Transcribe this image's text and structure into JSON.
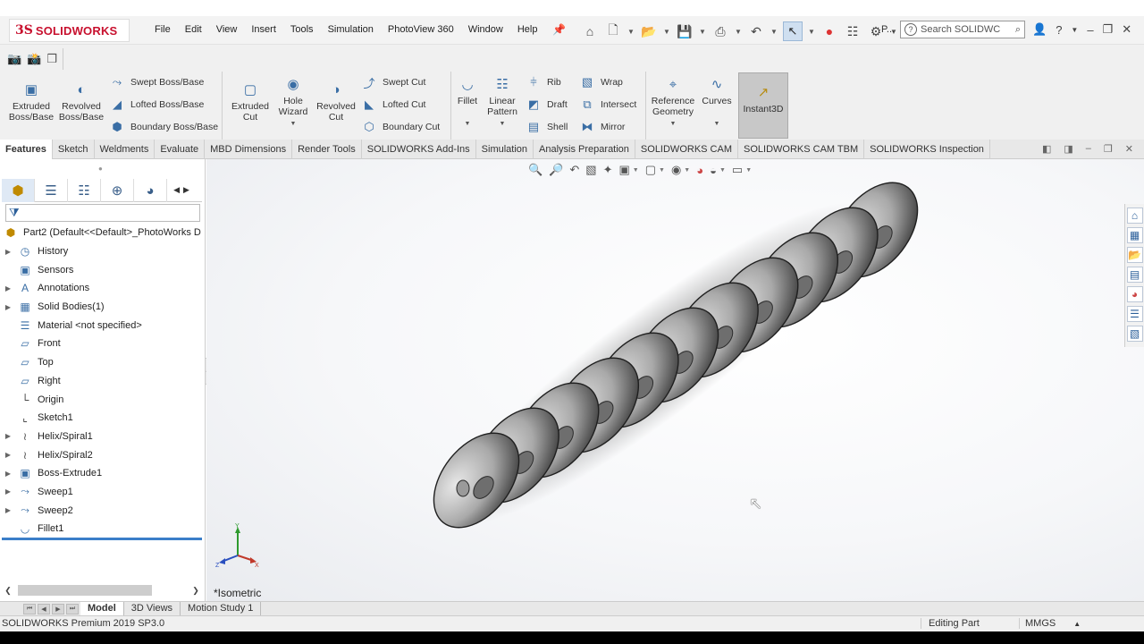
{
  "app": {
    "brand_ds": "3S",
    "brand_name": "SOLIDWORKS",
    "menu": [
      "File",
      "Edit",
      "View",
      "Insert",
      "Tools",
      "Simulation",
      "PhotoView 360",
      "Window",
      "Help"
    ],
    "p_label": "P...",
    "search_placeholder": "Search SOLIDWC",
    "colors": {
      "brand": "#c8102e",
      "accent": "#3b7ec9",
      "instant3d_bg": "#c8c8c8"
    }
  },
  "commands": {
    "extruded_boss": "Extruded Boss/Base",
    "revolved_boss": "Revolved Boss/Base",
    "swept_boss": "Swept Boss/Base",
    "lofted_boss": "Lofted Boss/Base",
    "boundary_boss": "Boundary Boss/Base",
    "extruded_cut": "Extruded Cut",
    "hole_wizard": "Hole Wizard",
    "revolved_cut": "Revolved Cut",
    "swept_cut": "Swept Cut",
    "lofted_cut": "Lofted Cut",
    "boundary_cut": "Boundary Cut",
    "fillet": "Fillet",
    "linear_pattern": "Linear Pattern",
    "rib": "Rib",
    "draft": "Draft",
    "shell": "Shell",
    "wrap": "Wrap",
    "intersect": "Intersect",
    "mirror": "Mirror",
    "reference_geometry": "Reference Geometry",
    "curves": "Curves",
    "instant3d": "Instant3D"
  },
  "tabs": [
    "Features",
    "Sketch",
    "Weldments",
    "Evaluate",
    "MBD Dimensions",
    "Render Tools",
    "SOLIDWORKS Add-Ins",
    "Simulation",
    "Analysis Preparation",
    "SOLIDWORKS CAM",
    "SOLIDWORKS CAM TBM",
    "SOLIDWORKS Inspection"
  ],
  "tree": {
    "root": "Part2  (Default<<Default>_PhotoWorks D",
    "items": [
      {
        "label": "History",
        "icon": "history-icon",
        "expandable": true
      },
      {
        "label": "Sensors",
        "icon": "sensor-icon",
        "expandable": false
      },
      {
        "label": "Annotations",
        "icon": "annotation-icon",
        "expandable": true
      },
      {
        "label": "Solid Bodies(1)",
        "icon": "solid-bodies-icon",
        "expandable": true
      },
      {
        "label": "Material <not specified>",
        "icon": "material-icon",
        "expandable": false
      },
      {
        "label": "Front",
        "icon": "plane-icon",
        "expandable": false
      },
      {
        "label": "Top",
        "icon": "plane-icon",
        "expandable": false
      },
      {
        "label": "Right",
        "icon": "plane-icon",
        "expandable": false
      },
      {
        "label": "Origin",
        "icon": "origin-icon",
        "expandable": false
      },
      {
        "label": "Sketch1",
        "icon": "sketch-icon",
        "expandable": false
      },
      {
        "label": "Helix/Spiral1",
        "icon": "helix-icon",
        "expandable": true
      },
      {
        "label": "Helix/Spiral2",
        "icon": "helix-icon",
        "expandable": true
      },
      {
        "label": "Boss-Extrude1",
        "icon": "extrude-icon",
        "expandable": true
      },
      {
        "label": "Sweep1",
        "icon": "sweep-icon",
        "expandable": true
      },
      {
        "label": "Sweep2",
        "icon": "sweep-icon",
        "expandable": true
      },
      {
        "label": "Fillet1",
        "icon": "fillet-icon",
        "expandable": false
      }
    ]
  },
  "graphics": {
    "view_label": "*Isometric",
    "triad": {
      "x": "X",
      "y": "Y",
      "z": "Z"
    }
  },
  "bottom_tabs": [
    "Model",
    "3D Views",
    "Motion Study 1"
  ],
  "status": {
    "version": "SOLIDWORKS Premium 2019 SP3.0",
    "mode": "Editing Part",
    "units": "MMGS"
  }
}
